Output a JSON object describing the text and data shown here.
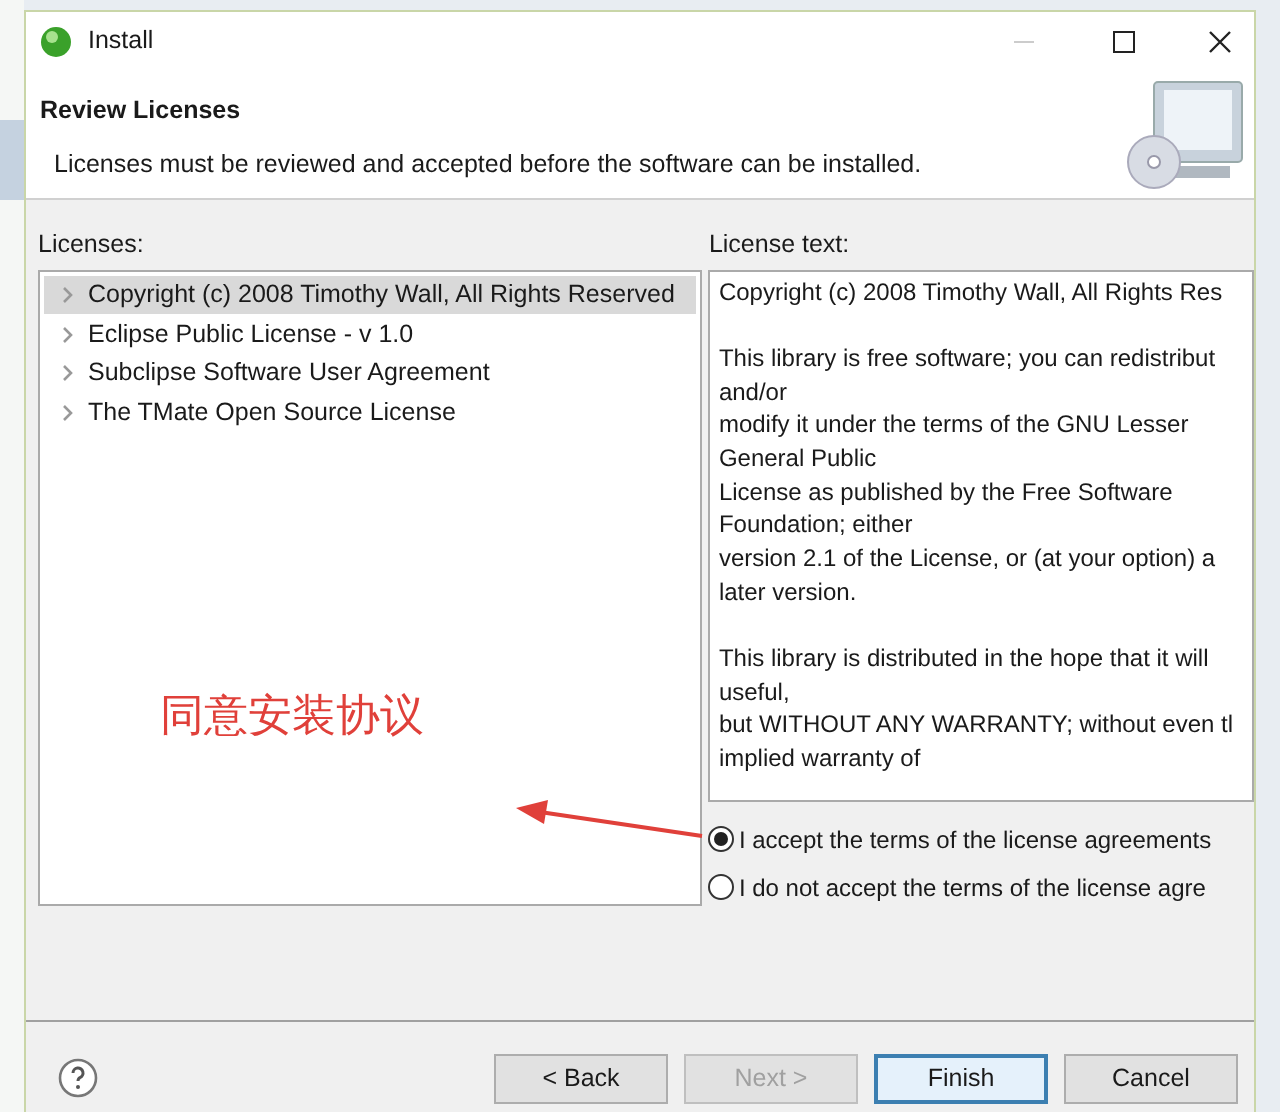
{
  "window": {
    "title": "Install"
  },
  "header": {
    "title": "Review Licenses",
    "description": "Licenses must be reviewed and accepted before the software can be installed."
  },
  "licenses": {
    "label": "Licenses:",
    "items": [
      {
        "label": "Copyright (c) 2008 Timothy Wall, All Rights Reserved",
        "selected": true
      },
      {
        "label": "Eclipse Public License - v 1.0",
        "selected": false
      },
      {
        "label": "Subclipse Software User Agreement",
        "selected": false
      },
      {
        "label": "The TMate Open Source License",
        "selected": false
      }
    ]
  },
  "license_text": {
    "label": "License text:",
    "paragraphs": [
      [
        "Copyright (c) 2008 Timothy Wall, All Rights Res"
      ],
      [
        "This library is free software; you can redistribut",
        "and/or",
        "modify it under the terms of the GNU Lesser",
        "General Public",
        "License as published by the Free Software",
        "Foundation; either",
        "version 2.1 of the License, or (at your option) a",
        "later version."
      ],
      [
        "This library is distributed in the hope that it will",
        "useful,",
        "but WITHOUT ANY WARRANTY; without even tl",
        "implied warranty of"
      ]
    ]
  },
  "agreement": [
    {
      "label": "I accept the terms of the license agreements",
      "selected": true
    },
    {
      "label": "I do not accept the terms of the license agre",
      "selected": false
    }
  ],
  "annotation": {
    "text": "同意安装协议"
  },
  "buttons": [
    {
      "label": "< Back",
      "disabled": false,
      "default": false
    },
    {
      "label": "Next >",
      "disabled": true,
      "default": false
    },
    {
      "label": "Finish",
      "disabled": false,
      "default": true
    },
    {
      "label": "Cancel",
      "disabled": false,
      "default": false
    }
  ]
}
